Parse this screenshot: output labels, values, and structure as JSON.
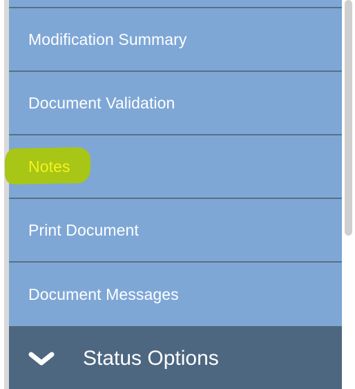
{
  "menu": {
    "items": [
      {
        "label": "Modification Summary"
      },
      {
        "label": "Document Validation"
      },
      {
        "label": "Notes"
      },
      {
        "label": "Print Document"
      },
      {
        "label": "Document Messages"
      }
    ],
    "active_index": 2
  },
  "status_section": {
    "label": "Status Options",
    "icon": "chevron-down-icon"
  },
  "colors": {
    "panel_bg": "#7ea7d6",
    "divider": "#5a6f85",
    "status_bar_bg": "#4d6781",
    "active_text": "#f3f31e",
    "highlight": "#a8c616",
    "scrollbar_thumb": "#cfcfcf"
  }
}
